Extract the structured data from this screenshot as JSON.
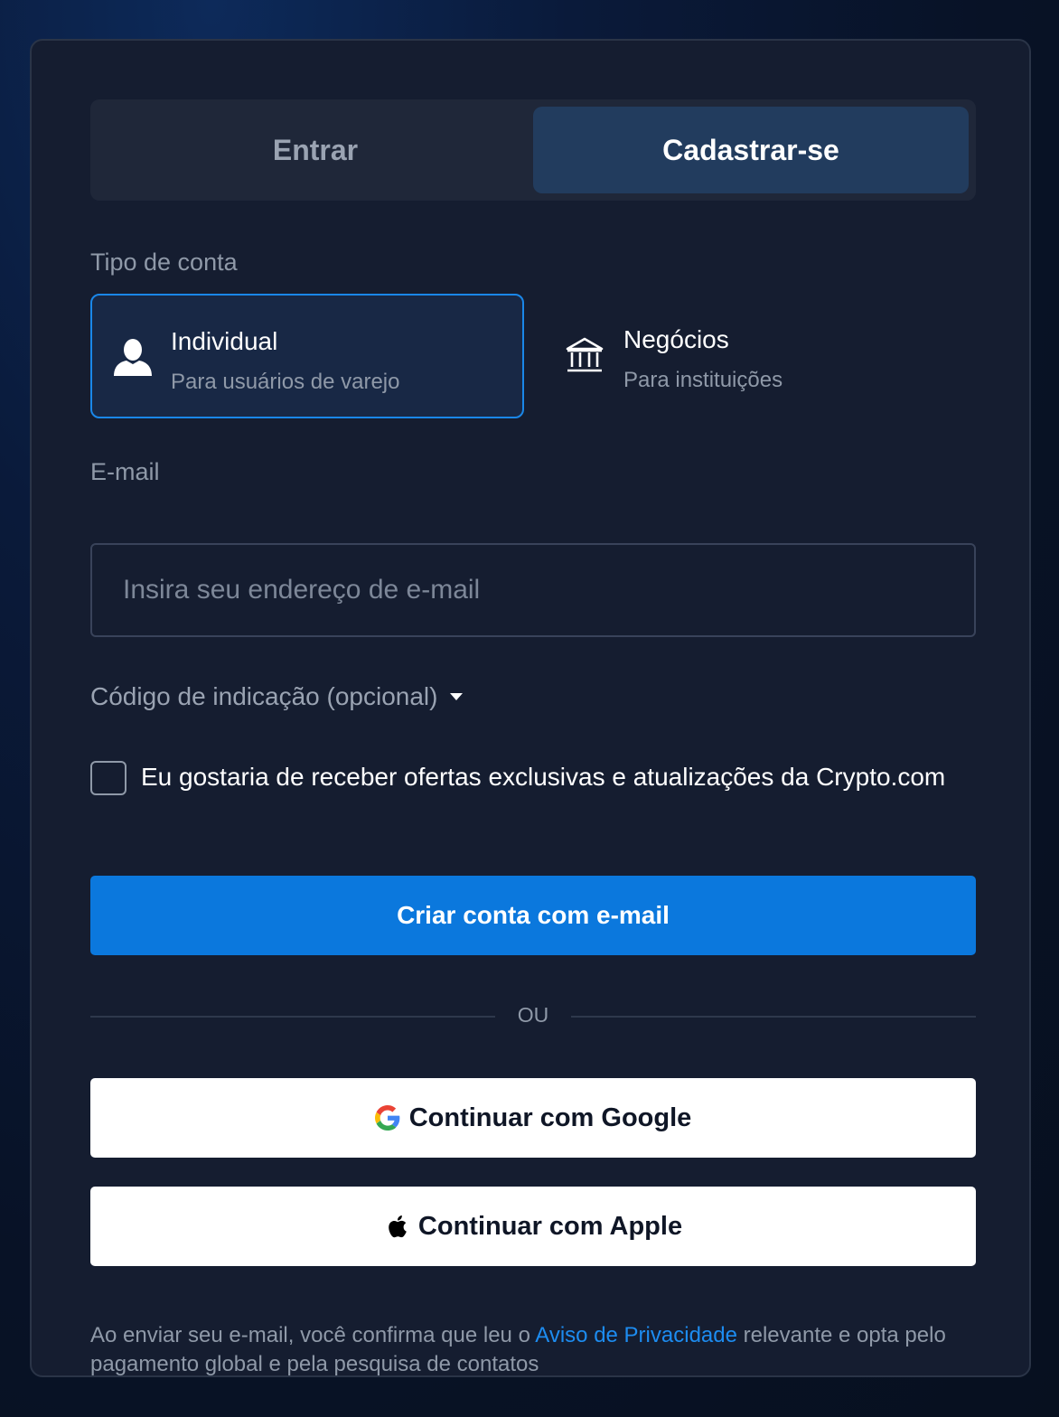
{
  "tabs": {
    "login": "Entrar",
    "signup": "Cadastrar-se",
    "active": "signup"
  },
  "account_type": {
    "label": "Tipo de conta",
    "individual": {
      "title": "Individual",
      "subtitle": "Para usuários de varejo",
      "icon": "person-icon",
      "selected": true
    },
    "business": {
      "title": "Negócios",
      "subtitle": "Para instituições",
      "icon": "bank-icon",
      "selected": false
    }
  },
  "email": {
    "label": "E-mail",
    "placeholder": "Insira seu endereço de e-mail",
    "value": ""
  },
  "referral": {
    "label": "Código de indicação (opcional)",
    "icon": "caret-down-icon"
  },
  "offers": {
    "checked": false,
    "text": "Eu gostaria de receber ofertas exclusivas e atualizações da Crypto.com"
  },
  "create_button": "Criar conta com e-mail",
  "divider": "OU",
  "google_button": "Continuar com Google",
  "apple_button": "Continuar com Apple",
  "footer": {
    "before": "Ao enviar seu e-mail, você confirma que leu o ",
    "link": "Aviso de Privacidade",
    "after": " relevante e opta pelo pagamento global e pela pesquisa de contatos"
  },
  "colors": {
    "accent": "#0b78dd",
    "card": "#151d30",
    "link": "#1d8cf0"
  }
}
